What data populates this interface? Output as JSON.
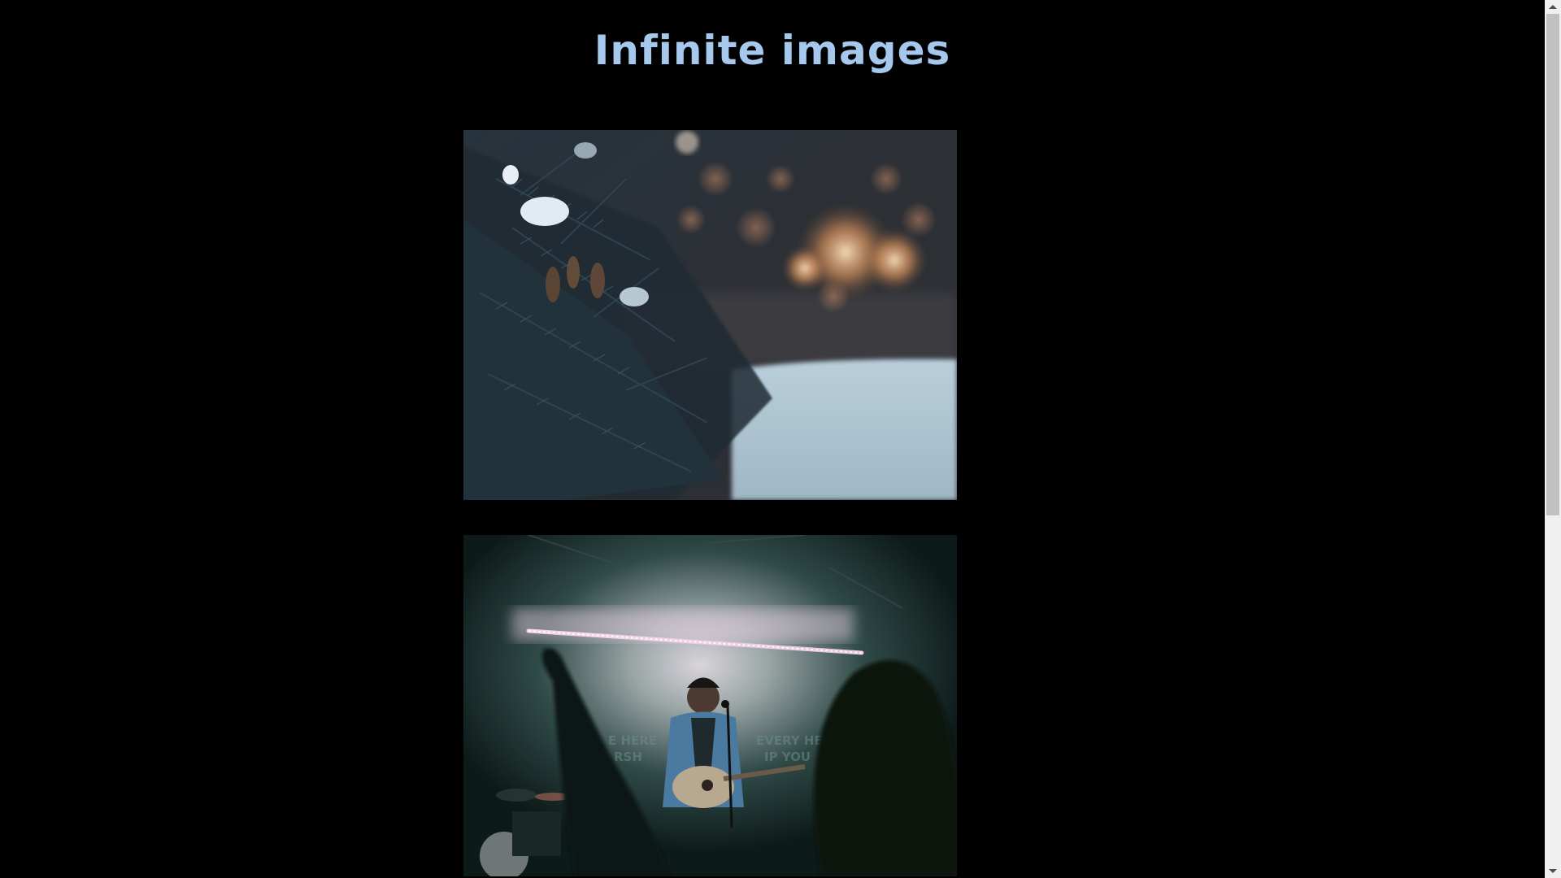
{
  "page": {
    "title": "Infinite images",
    "title_color": "#a6c8ec",
    "background": "#000000"
  },
  "gallery": {
    "images": [
      {
        "description_icon": "winter-pine-bokeh-photo"
      },
      {
        "description_icon": "concert-guitarist-photo"
      }
    ]
  },
  "scrollbar": {
    "position_fraction": 0.0,
    "visible_fraction": 0.59
  }
}
